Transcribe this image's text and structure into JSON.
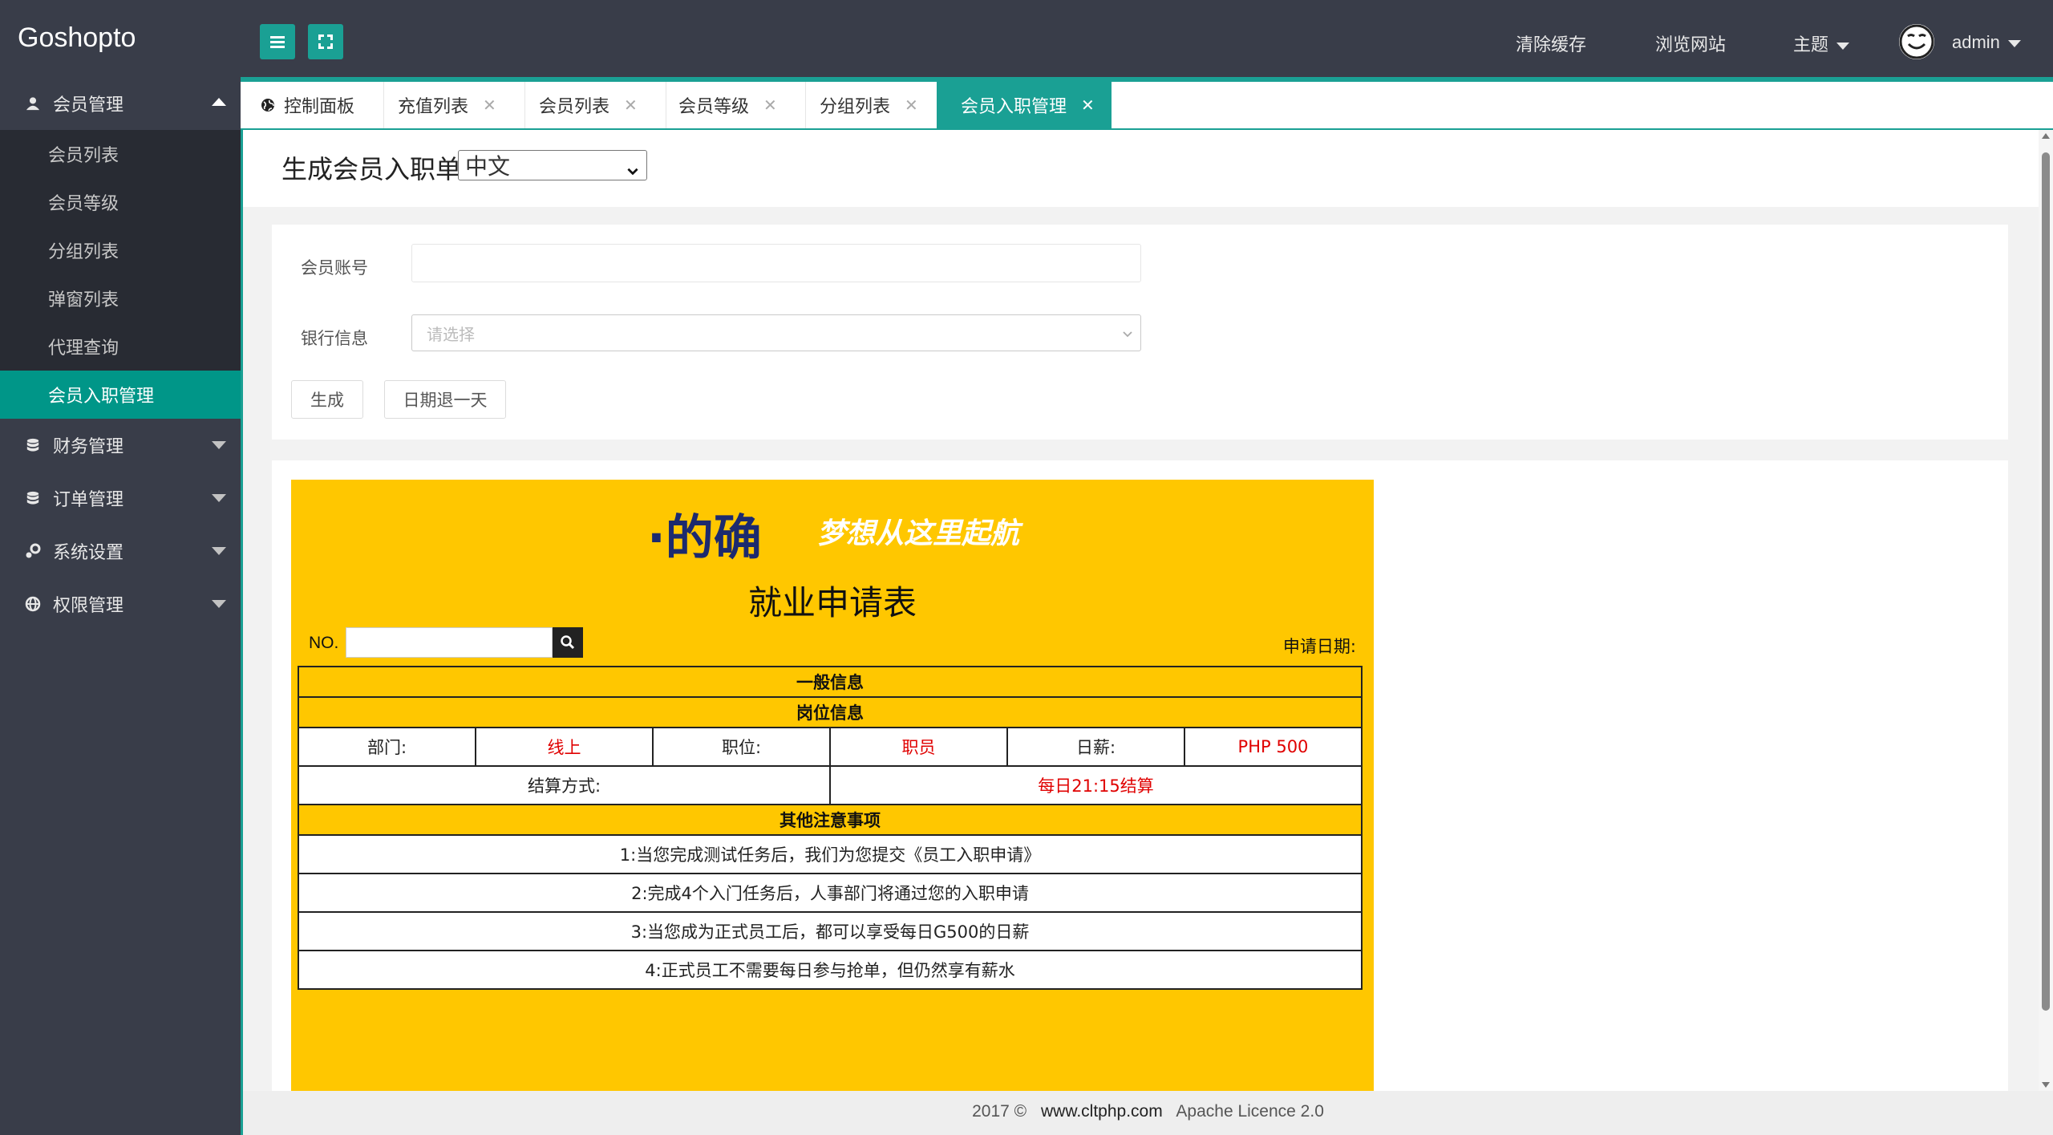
{
  "app": {
    "logo": "Goshopto"
  },
  "topbar": {
    "clear_cache": "清除缓存",
    "browse_site": "浏览网站",
    "theme": "主题",
    "username": "admin"
  },
  "sidebar": {
    "groups": [
      {
        "label": "会员管理",
        "icon": "user-icon",
        "expanded": true,
        "items": [
          {
            "label": "会员列表"
          },
          {
            "label": "会员等级"
          },
          {
            "label": "分组列表"
          },
          {
            "label": "弹窗列表"
          },
          {
            "label": "代理查询"
          },
          {
            "label": "会员入职管理",
            "active": true
          }
        ]
      },
      {
        "label": "财务管理",
        "icon": "database-icon"
      },
      {
        "label": "订单管理",
        "icon": "database-icon"
      },
      {
        "label": "系统设置",
        "icon": "gears-icon"
      },
      {
        "label": "权限管理",
        "icon": "globe-icon"
      }
    ]
  },
  "tabs": [
    {
      "label": "控制面板",
      "icon": "globe-icon",
      "closable": false
    },
    {
      "label": "充值列表",
      "closable": true
    },
    {
      "label": "会员列表",
      "closable": true
    },
    {
      "label": "会员等级",
      "closable": true
    },
    {
      "label": "分组列表",
      "closable": true
    },
    {
      "label": "会员入职管理",
      "closable": true,
      "active": true
    }
  ],
  "page": {
    "title": "生成会员入职单",
    "language_selected": "中文"
  },
  "form": {
    "account_label": "会员账号",
    "account_value": "",
    "bank_label": "银行信息",
    "bank_placeholder": "请选择",
    "generate_button": "生成",
    "date_back_button": "日期退一天"
  },
  "document": {
    "brand": "·的确",
    "slogan": "梦想从这里起航",
    "title": "就业申请表",
    "no_label": "NO.",
    "no_value": "",
    "apply_date_label": "申请日期:",
    "section_general": "一般信息",
    "section_position": "岗位信息",
    "dept_label": "部门:",
    "dept_value": "线上",
    "position_label": "职位:",
    "position_value": "职员",
    "salary_label": "日薪:",
    "salary_value": "PHP 500",
    "settlement_label": "结算方式:",
    "settlement_value": "每日21:15结算",
    "section_notes": "其他注意事项",
    "notes": [
      "1:当您完成测试任务后，我们为您提交《员工入职申请》",
      "2:完成4个入门任务后，人事部门将通过您的入职申请",
      "3:当您成为正式员工后，都可以享受每日G500的日薪",
      "4:正式员工不需要每日参与抢单，但仍然享有薪水"
    ]
  },
  "footer": {
    "year": "2017 ©",
    "url": "www.cltphp.com",
    "licence": "Apache Licence 2.0"
  },
  "colors": {
    "topbar": "#393d49",
    "accent": "#009688",
    "doc_background": "#ffc700",
    "brand_text": "#1c2a6e",
    "value_red": "#e00000"
  }
}
